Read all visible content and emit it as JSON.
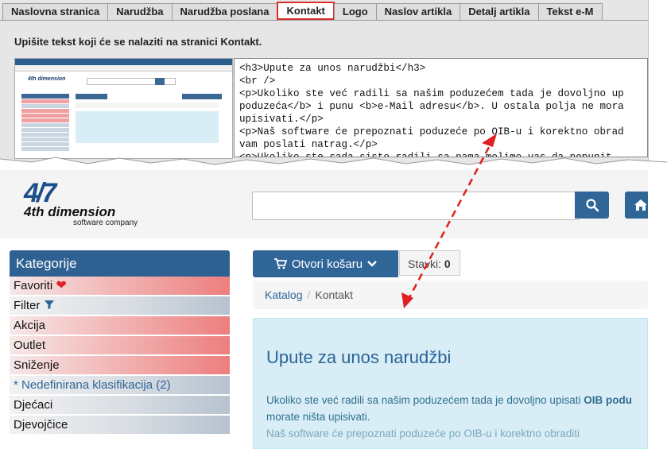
{
  "tabs": [
    {
      "label": "Naslovna stranica",
      "active": false
    },
    {
      "label": "Narudžba",
      "active": false
    },
    {
      "label": "Narudžba poslana",
      "active": false
    },
    {
      "label": "Kontakt",
      "active": true
    },
    {
      "label": "Logo",
      "active": false
    },
    {
      "label": "Naslov artikla",
      "active": false
    },
    {
      "label": "Detalj artikla",
      "active": false
    },
    {
      "label": "Tekst e-M",
      "active": false
    }
  ],
  "instruction": "Upišite tekst koji će se nalaziti na stranici Kontakt.",
  "editor_text": "<h3>Upute za unos narudžbi</h3>\n<br />\n<p>Ukoliko ste već radili sa našim poduzećem tada je dovoljno up\npoduzeća</b> i punu <b>e-Mail adresu</b>. U ostala polja ne mora\nupisivati.</p>\n<p>Naš software će prepoznati poduzeće po OIB-u i korektno obrad\nvam poslati natrag.</p>\n<p>Ukoliko ste sada sisto radili sa nama molimo vas da popunit",
  "site": {
    "logo_mark": "4/7",
    "logo_name": "4th dimension",
    "logo_sub": "software company",
    "search_placeholder": ""
  },
  "sidebar": {
    "title": "Kategorije",
    "items": [
      {
        "label": "Favoriti",
        "style": "red",
        "icon": "heart-icon"
      },
      {
        "label": "Filter",
        "style": "gray",
        "icon": "filter-icon"
      },
      {
        "label": "Akcija",
        "style": "red"
      },
      {
        "label": "Outlet",
        "style": "red"
      },
      {
        "label": "Sniženje",
        "style": "red"
      },
      {
        "label": "* Nedefinirana klasifikacija (2)",
        "style": "gray"
      },
      {
        "label": "Djećaci",
        "style": "gray"
      },
      {
        "label": "Djevojčice",
        "style": "gray"
      }
    ]
  },
  "cart": {
    "button_label": "Otvori košaru",
    "stavki_label": "Stavki:",
    "stavki_count": "0"
  },
  "breadcrumb": {
    "link": "Katalog",
    "current": "Kontakt"
  },
  "content": {
    "title": "Upute za unos narudžbi",
    "p1_start": "Ukoliko ste već radili sa našim poduzećem tada je dovoljno upisati ",
    "p1_bold": "OIB podu",
    "p1_end": "morate ništa upisivati.",
    "p2": "Naš software će prepoznati poduzeće po OIB-u i korektno obraditi"
  },
  "colors": {
    "brand_blue": "#2f6597",
    "tab_highlight": "#d9302c",
    "arrow": "#e02020"
  }
}
